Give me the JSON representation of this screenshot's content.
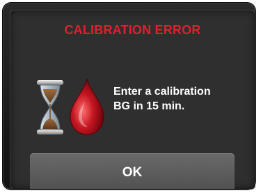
{
  "dialog": {
    "title": "CALIBRATION ERROR",
    "message_line1": "Enter a calibration",
    "message_line2": "BG in 15 min.",
    "ok_label": "OK"
  },
  "icons": {
    "hourglass": "hourglass-icon",
    "blood_drop": "blood-drop-icon"
  },
  "colors": {
    "title": "#e11f2e",
    "screen_background": "#2f2f2f",
    "button_background": "#5b5b5b",
    "text": "#ffffff"
  }
}
